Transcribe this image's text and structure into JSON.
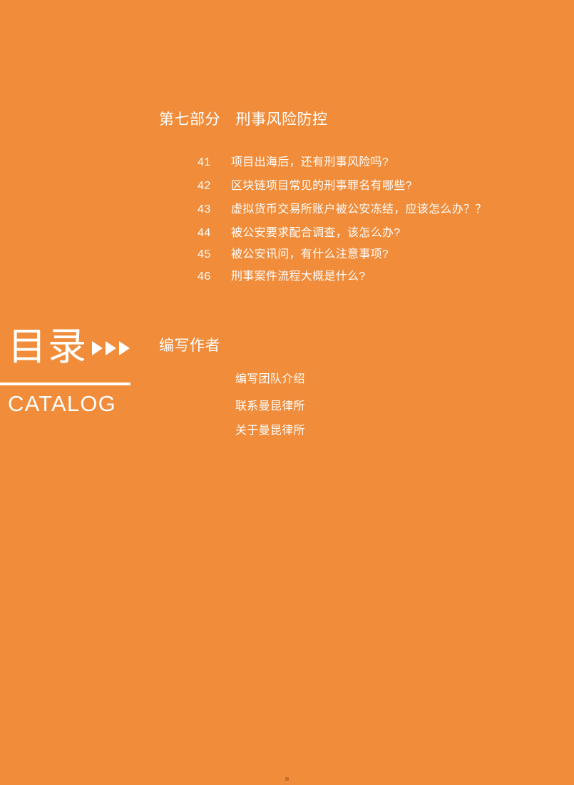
{
  "page": {
    "background_color": "#f08c3a",
    "text_color": "#ffffff"
  },
  "catalog": {
    "title_cn": "目录",
    "title_en": "CATALOG",
    "arrow_icon_count": 3,
    "arrow_icon": "play-triangle-right"
  },
  "sections": [
    {
      "heading": "第七部分　刑事风险防控",
      "entries": [
        {
          "number": "41",
          "title": "项目出海后，还有刑事风险吗?"
        },
        {
          "number": "42",
          "title": "区块链项目常见的刑事罪名有哪些?"
        },
        {
          "number": "43",
          "title": "虚拟货币交易所账户被公安冻结，应该怎么办？？"
        },
        {
          "number": "44",
          "title": "被公安要求配合调查，该怎么办?"
        },
        {
          "number": "45",
          "title": "被公安讯问，有什么注意事项?"
        },
        {
          "number": "46",
          "title": " 刑事案件流程大概是什么?"
        }
      ]
    },
    {
      "heading": "编写作者",
      "sub_entries": [
        {
          "title": "编写团队介绍"
        },
        {
          "title": "联系曼昆律所"
        },
        {
          "title": "关于曼昆律所"
        }
      ]
    }
  ]
}
